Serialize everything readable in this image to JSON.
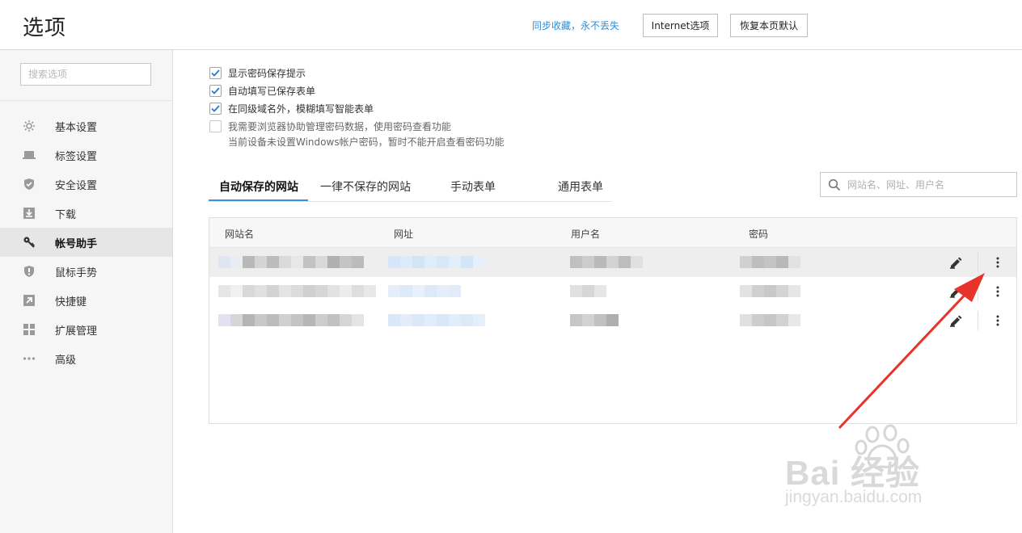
{
  "header": {
    "title": "选项",
    "sync_link": "同步收藏，永不丢失",
    "internet_button": "Internet选项",
    "restore_button": "恢复本页默认"
  },
  "sidebar": {
    "search_placeholder": "搜索选项",
    "active_index": 3,
    "items": [
      {
        "label": "基本设置",
        "icon": "gear-icon"
      },
      {
        "label": "标签设置",
        "icon": "tab-icon"
      },
      {
        "label": "安全设置",
        "icon": "shield-check-icon"
      },
      {
        "label": "下载",
        "icon": "download-icon"
      },
      {
        "label": "帐号助手",
        "icon": "key-icon"
      },
      {
        "label": "鼠标手势",
        "icon": "shield-exclamation-icon"
      },
      {
        "label": "快捷键",
        "icon": "shortcut-arrow-icon"
      },
      {
        "label": "扩展管理",
        "icon": "grid-icon"
      },
      {
        "label": "高级",
        "icon": "more-dots-icon"
      }
    ]
  },
  "options": [
    {
      "label": "显示密码保存提示",
      "checked": true
    },
    {
      "label": "自动填写已保存表单",
      "checked": true
    },
    {
      "label": "在同级域名外，模糊填写智能表单",
      "checked": true
    },
    {
      "label": "我需要浏览器协助管理密码数据，使用密码查看功能",
      "checked": false,
      "disabled": true
    }
  ],
  "option_note": "当前设备未设置Windows帐户密码，暂时不能开启查看密码功能",
  "tabs": [
    {
      "label": "自动保存的网站",
      "active": true
    },
    {
      "label": "一律不保存的网站",
      "active": false
    },
    {
      "label": "手动表单",
      "active": false
    },
    {
      "label": "通用表单",
      "active": false
    }
  ],
  "site_search": {
    "placeholder": "网站名、网址、用户名"
  },
  "table": {
    "columns": [
      "网站名",
      "网址",
      "用户名",
      "密码"
    ],
    "rows": [
      {
        "site_name": "",
        "url": "",
        "username": "",
        "password": "",
        "redacted": true,
        "hovered": true
      },
      {
        "site_name": "",
        "url": "",
        "username": "",
        "password": "",
        "redacted": true,
        "hovered": false
      },
      {
        "site_name": "",
        "url": "",
        "username": "",
        "password": "",
        "redacted": true,
        "hovered": false
      }
    ]
  },
  "watermark": {
    "brand": "Bai  经验",
    "url": "jingyan.baidu.com"
  },
  "colors": {
    "accent": "#3b8ee0",
    "link": "#2b8fd8",
    "check": "#2f73c7",
    "annotation_arrow": "#e8332a",
    "sidebar_bg": "#f6f6f6",
    "sidebar_active": "#e6e6e6"
  }
}
